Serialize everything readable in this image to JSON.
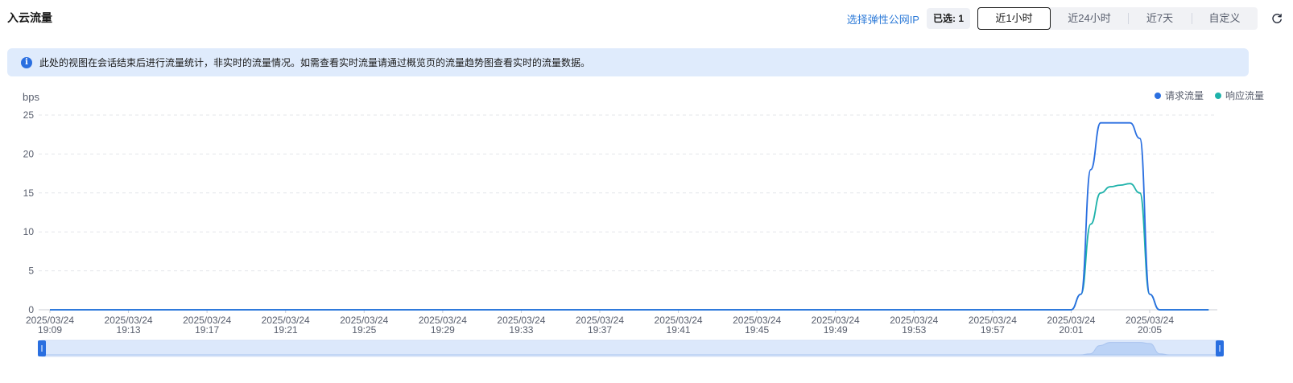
{
  "header": {
    "title": "入云流量",
    "select_ip_link": "选择弹性公网IP",
    "selected_count": "已选: 1",
    "ranges": [
      "近1小时",
      "近24小时",
      "近7天",
      "自定义"
    ],
    "active_range": "近1小时"
  },
  "info_banner": {
    "icon": "info-icon",
    "text": "此处的视图在会话结束后进行流量统计，非实时的流量情况。如需查看实时流量请通过概览页的流量趋势图查看实时的流量数据。"
  },
  "chart_data": {
    "type": "line",
    "ylabel": "bps",
    "ylim": [
      0,
      25
    ],
    "y_ticks": [
      0,
      5,
      10,
      15,
      20,
      25
    ],
    "x_tick_labels": [
      [
        "2025/03/24",
        "19:09"
      ],
      [
        "2025/03/24",
        "19:13"
      ],
      [
        "2025/03/24",
        "19:17"
      ],
      [
        "2025/03/24",
        "19:21"
      ],
      [
        "2025/03/24",
        "19:25"
      ],
      [
        "2025/03/24",
        "19:29"
      ],
      [
        "2025/03/24",
        "19:33"
      ],
      [
        "2025/03/24",
        "19:37"
      ],
      [
        "2025/03/24",
        "19:41"
      ],
      [
        "2025/03/24",
        "19:45"
      ],
      [
        "2025/03/24",
        "19:49"
      ],
      [
        "2025/03/24",
        "19:53"
      ],
      [
        "2025/03/24",
        "19:57"
      ],
      [
        "2025/03/24",
        "20:01"
      ],
      [
        "2025/03/24",
        "20:05"
      ]
    ],
    "x_time_unit": "minutes",
    "x_range": [
      "19:09",
      "20:08"
    ],
    "grid": true,
    "legend_position": "top-right",
    "series": [
      {
        "name": "请求流量",
        "color": "#2a6fe0",
        "points": [
          [
            "19:09",
            0
          ],
          [
            "20:01",
            0
          ],
          [
            "20:01:30",
            2
          ],
          [
            "20:02",
            18
          ],
          [
            "20:02:30",
            24
          ],
          [
            "20:03",
            24
          ],
          [
            "20:03:30",
            24
          ],
          [
            "20:04",
            24
          ],
          [
            "20:04:30",
            22
          ],
          [
            "20:05",
            2
          ],
          [
            "20:05:30",
            0
          ],
          [
            "20:08",
            0
          ]
        ]
      },
      {
        "name": "响应流量",
        "color": "#1eb2aa",
        "points": [
          [
            "19:09",
            0
          ],
          [
            "20:01",
            0
          ],
          [
            "20:01:30",
            2
          ],
          [
            "20:02",
            11
          ],
          [
            "20:02:30",
            15
          ],
          [
            "20:03",
            15.8
          ],
          [
            "20:03:30",
            16
          ],
          [
            "20:04",
            16.2
          ],
          [
            "20:04:30",
            15
          ],
          [
            "20:05",
            2
          ],
          [
            "20:05:30",
            0
          ],
          [
            "20:08",
            0
          ]
        ]
      }
    ],
    "zoom_range": [
      0,
      100
    ]
  }
}
